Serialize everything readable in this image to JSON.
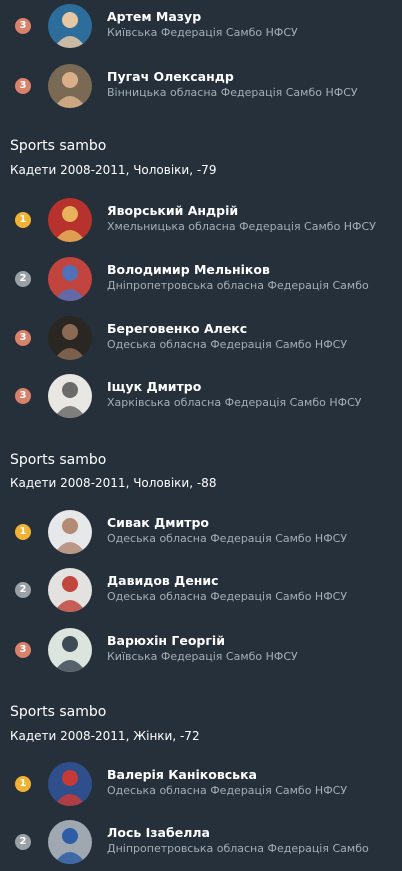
{
  "rows_top": [
    {
      "place": "3",
      "name": "Артем Мазур",
      "org": "Київська Федерація Самбо НФСУ",
      "colors": {
        "bg": "#2c6d9c",
        "fg": "#e6c7a5"
      }
    },
    {
      "place": "3",
      "name": "Пугач Олександр",
      "org": "Вінницька обласна Федерація Самбо НФСУ",
      "colors": {
        "bg": "#7a6a55",
        "fg": "#d9b08a"
      }
    }
  ],
  "groups": [
    {
      "sport": "Sports sambo",
      "category": "Кадети 2008-2011, Чоловіки, -79",
      "rows": [
        {
          "place": "1",
          "name": "Яворський Андрій",
          "org": "Хмельницька обласна Федерація Самбо НФСУ",
          "colors": {
            "bg": "#b7322c",
            "fg": "#e7b25a"
          }
        },
        {
          "place": "2",
          "name": "Володимир Мельніков",
          "org": "Дніпропетровська обласна Федерація Самбо",
          "colors": {
            "bg": "#c2443f",
            "fg": "#5170b8"
          }
        },
        {
          "place": "3",
          "name": "Береговенко Алекс",
          "org": "Одеська обласна Федерація Самбо НФСУ",
          "colors": {
            "bg": "#2a2622",
            "fg": "#8a6a55"
          }
        },
        {
          "place": "3",
          "name": "Іщук Дмитро",
          "org": "Харківська обласна Федерація Самбо НФСУ",
          "colors": {
            "bg": "#e9e7e3",
            "fg": "#6b6b6b"
          }
        }
      ]
    },
    {
      "sport": "Sports sambo",
      "category": "Кадети 2008-2011, Чоловіки, -88",
      "rows": [
        {
          "place": "1",
          "name": "Сивак Дмитро",
          "org": "Одеська обласна Федерація Самбо НФСУ",
          "colors": {
            "bg": "#e6e8ea",
            "fg": "#b38a74"
          }
        },
        {
          "place": "2",
          "name": "Давидов Денис",
          "org": "Одеська обласна Федерація Самбо НФСУ",
          "colors": {
            "bg": "#e4e2e0",
            "fg": "#c0463e"
          }
        },
        {
          "place": "3",
          "name": "Варюхін Георгій",
          "org": "Київська Федерація Самбо НФСУ",
          "colors": {
            "bg": "#dbe5dd",
            "fg": "#3d4b57"
          }
        }
      ]
    },
    {
      "sport": "Sports sambo",
      "category": "Кадети 2008-2011, Жінки, -72",
      "rows": [
        {
          "place": "1",
          "name": "Валерія Каніковська",
          "org": "Одеська обласна Федерація Самбо НФСУ",
          "colors": {
            "bg": "#2f4f8c",
            "fg": "#c53a39"
          }
        },
        {
          "place": "2",
          "name": "Лось Ізабелла",
          "org": "Дніпропетровська обласна Федерація Самбо",
          "colors": {
            "bg": "#9fa7b1",
            "fg": "#2e5da6"
          }
        }
      ]
    }
  ],
  "medal_colors": {
    "gold": "#f0b235",
    "silver": "#9aa0a6",
    "bronze": "#d9826b"
  },
  "icons": {
    "avatar": "athlete-photo"
  }
}
